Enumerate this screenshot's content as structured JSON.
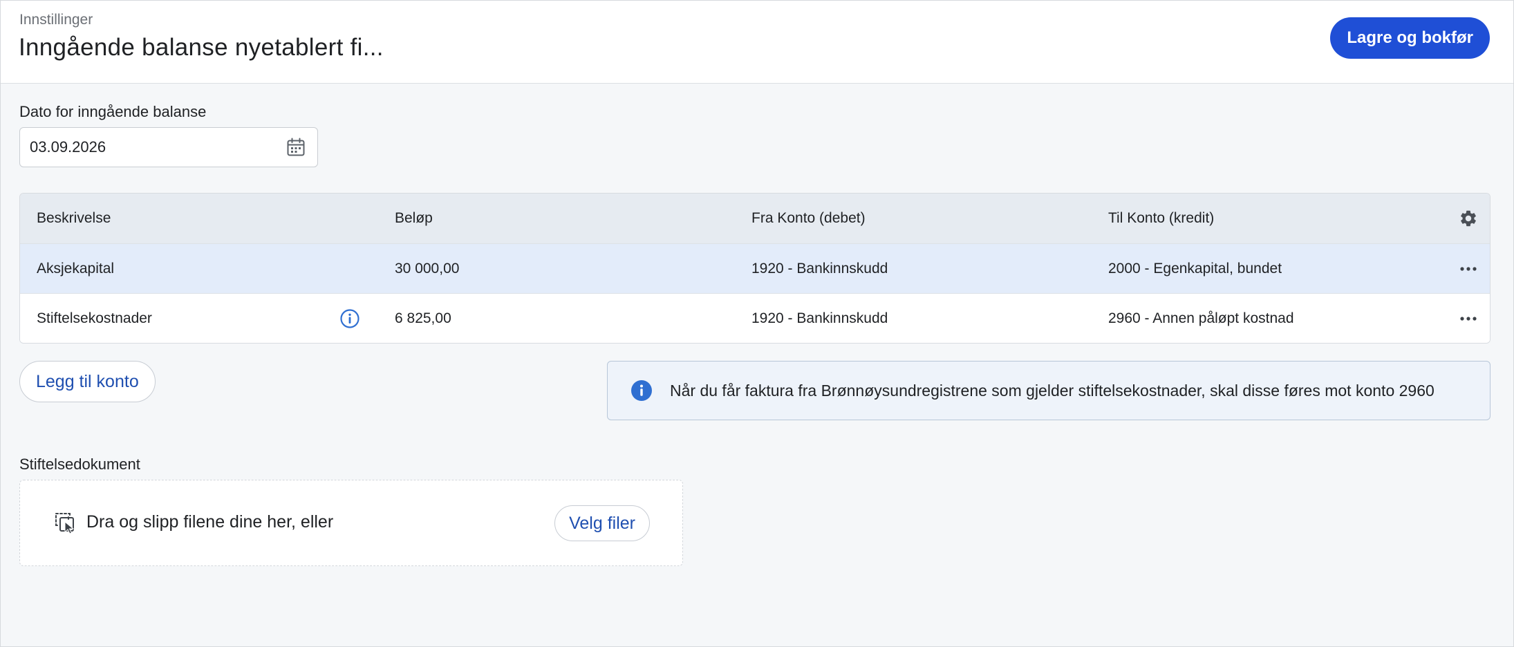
{
  "header": {
    "breadcrumb": "Innstillinger",
    "title": "Inngående balanse nyetablert fi...",
    "save_label": "Lagre og bokfør"
  },
  "date_section": {
    "label": "Dato for inngående balanse",
    "value": "03.09.2026",
    "icon": "calendar-icon"
  },
  "table": {
    "columns": [
      "Beskrivelse",
      "Beløp",
      "Fra Konto (debet)",
      "Til Konto (kredit)"
    ],
    "settings_icon": "gear-icon",
    "rows": [
      {
        "description": "Aksjekapital",
        "amount": "30 000,00",
        "from_account": "1920 - Bankinnskudd",
        "to_account": "2000 - Egenkapital, bundet",
        "has_info": false,
        "selected": true
      },
      {
        "description": "Stiftelsekostnader",
        "amount": "6 825,00",
        "from_account": "1920 - Bankinnskudd",
        "to_account": "2960 - Annen påløpt kostnad",
        "has_info": true,
        "selected": false
      }
    ]
  },
  "add_account_label": "Legg til konto",
  "info_banner": {
    "text": "Når du får faktura fra Brønnøysundregistrene som gjelder stiftelsekostnader, skal disse føres mot konto 2960"
  },
  "document": {
    "label": "Stiftelsedokument",
    "drop_text": "Dra og slipp filene dine her, eller",
    "choose_label": "Velg filer"
  },
  "colors": {
    "primary": "#1f4fd6",
    "link": "#1f4fb0",
    "selected_row": "#e3ecfa",
    "header_row": "#e6ebf1",
    "info_icon": "#2f6fd1"
  }
}
